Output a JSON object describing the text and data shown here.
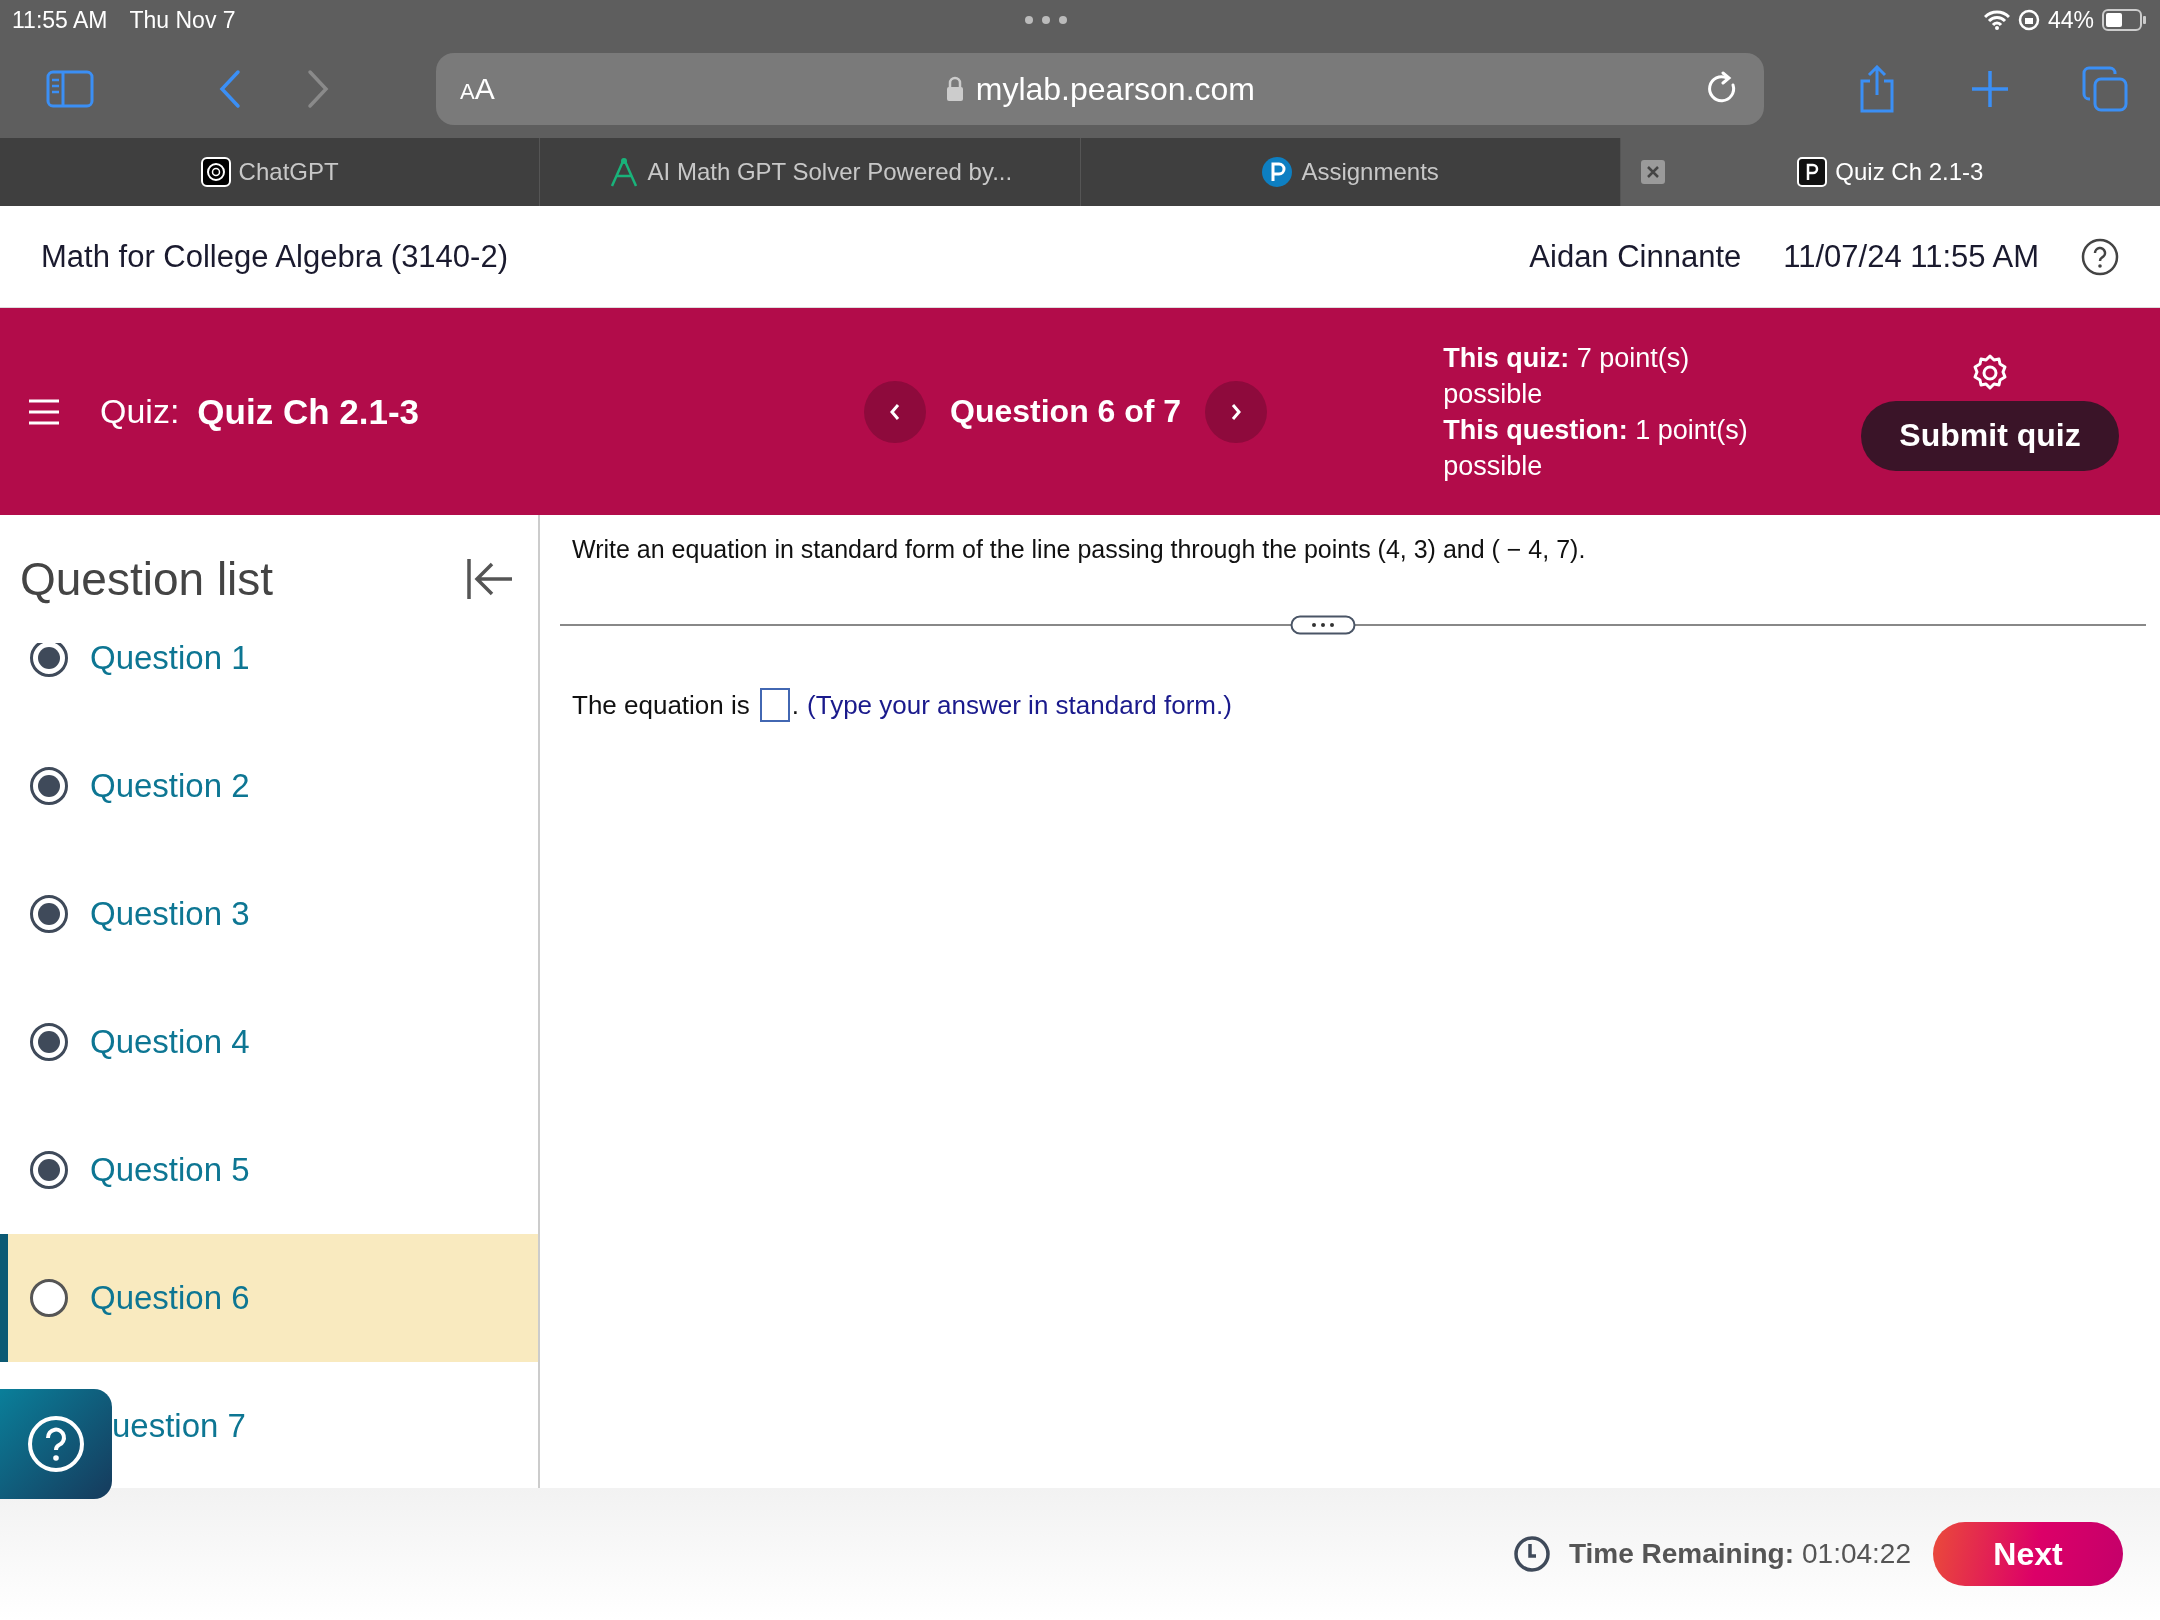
{
  "status_bar": {
    "time": "11:55 AM",
    "date": "Thu Nov 7",
    "battery": "44%"
  },
  "browser": {
    "text_size": "AA",
    "url": "mylab.pearson.com"
  },
  "tabs": [
    {
      "label": "ChatGPT",
      "kind": "chatgpt",
      "selected": false
    },
    {
      "label": "AI Math GPT Solver Powered by...",
      "kind": "solver",
      "selected": false
    },
    {
      "label": "Assignments",
      "kind": "pearson",
      "selected": false
    },
    {
      "label": "Quiz Ch 2.1-3",
      "kind": "page",
      "selected": true
    }
  ],
  "course": {
    "title": "Math for College Algebra (3140-2)",
    "user": "Aidan Cinnante",
    "datetime": "11/07/24 11:55 AM"
  },
  "quiz": {
    "label": "Quiz:",
    "name": "Quiz Ch 2.1-3",
    "position": "Question 6 of 7",
    "points": [
      "**This quiz:** 7 point(s) possible",
      "**This question:** 1 point(s) possible"
    ],
    "submit": "Submit quiz"
  },
  "question_list": {
    "title": "Question list",
    "items": [
      {
        "label": "Question 1",
        "answered": true,
        "selected": false
      },
      {
        "label": "Question 2",
        "answered": true,
        "selected": false
      },
      {
        "label": "Question 3",
        "answered": true,
        "selected": false
      },
      {
        "label": "Question 4",
        "answered": true,
        "selected": false
      },
      {
        "label": "Question 5",
        "answered": true,
        "selected": false
      },
      {
        "label": "Question 6",
        "answered": false,
        "selected": true
      },
      {
        "label": "uestion 7",
        "selected": false
      }
    ]
  },
  "question": {
    "prompt": "Write an equation in standard form of the line passing through the points (4, 3) and ( − 4, 7).",
    "answer_lead": "The equation is",
    "answer_after": ".",
    "hint": "(Type your answer in standard form.)"
  },
  "footer": {
    "time_label": "Time Remaining:",
    "time_value": "01:04:22",
    "next": "Next"
  }
}
